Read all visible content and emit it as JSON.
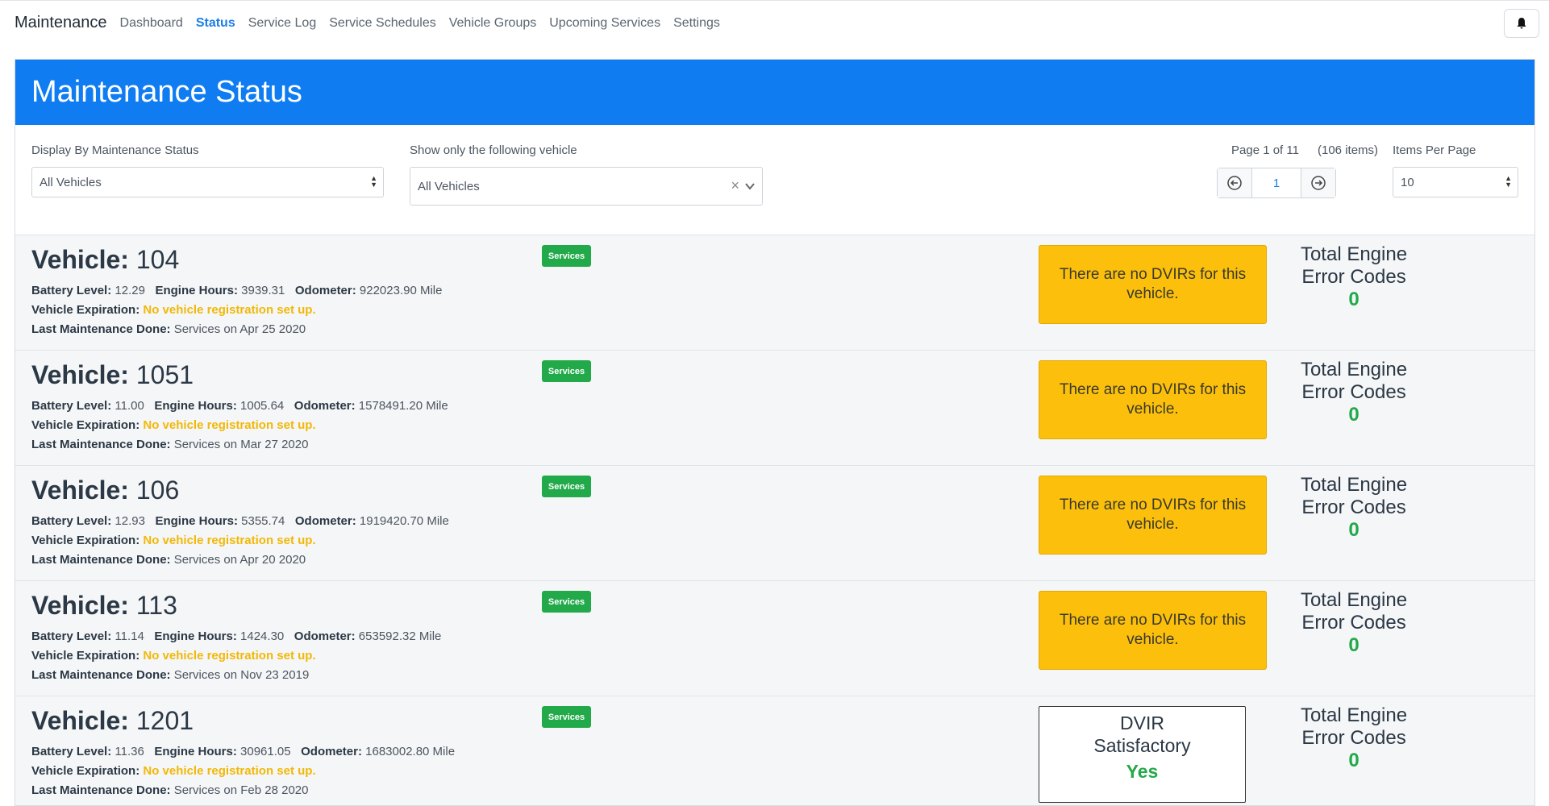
{
  "nav": {
    "brand": "Maintenance",
    "links": [
      "Dashboard",
      "Status",
      "Service Log",
      "Service Schedules",
      "Vehicle Groups",
      "Upcoming Services",
      "Settings"
    ],
    "active": "Status",
    "bell_icon": "bell-icon"
  },
  "header": {
    "title": "Maintenance Status"
  },
  "filters": {
    "status_label": "Display By Maintenance Status",
    "status_value": "All Vehicles",
    "vehicle_label": "Show only the following vehicle",
    "vehicle_value": "All Vehicles",
    "page_info": "Page 1 of 11",
    "items_info": "(106 items)",
    "current_page": "1",
    "per_page_label": "Items Per Page",
    "per_page_value": "10"
  },
  "labels": {
    "vehicle": "Vehicle:",
    "battery": "Battery Level:",
    "engine_hours": "Engine Hours:",
    "odometer": "Odometer:",
    "expiration": "Vehicle Expiration:",
    "last_maint": "Last Maintenance Done:",
    "services_badge": "Services",
    "no_dvir": "There are no DVIRs for this vehicle.",
    "dvir_sat": "DVIR Satisfactory",
    "engine_codes": "Total Engine Error Codes"
  },
  "vehicles": [
    {
      "id": "104",
      "battery": "12.29",
      "hours": "3939.31",
      "odometer": "922023.90 Mile",
      "expiration": "No vehicle registration set up.",
      "last": "Services on Apr 25 2020",
      "dvir": "none",
      "codes": "0"
    },
    {
      "id": "1051",
      "battery": "11.00",
      "hours": "1005.64",
      "odometer": "1578491.20 Mile",
      "expiration": "No vehicle registration set up.",
      "last": "Services on Mar 27 2020",
      "dvir": "none",
      "codes": "0"
    },
    {
      "id": "106",
      "battery": "12.93",
      "hours": "5355.74",
      "odometer": "1919420.70 Mile",
      "expiration": "No vehicle registration set up.",
      "last": "Services on Apr 20 2020",
      "dvir": "none",
      "codes": "0"
    },
    {
      "id": "113",
      "battery": "11.14",
      "hours": "1424.30",
      "odometer": "653592.32 Mile",
      "expiration": "No vehicle registration set up.",
      "last": "Services on Nov 23 2019",
      "dvir": "none",
      "codes": "0"
    },
    {
      "id": "1201",
      "battery": "11.36",
      "hours": "30961.05",
      "odometer": "1683002.80 Mile",
      "expiration": "No vehicle registration set up.",
      "last": "Services on Feb 28 2020",
      "dvir": "Yes",
      "codes": "0"
    }
  ]
}
